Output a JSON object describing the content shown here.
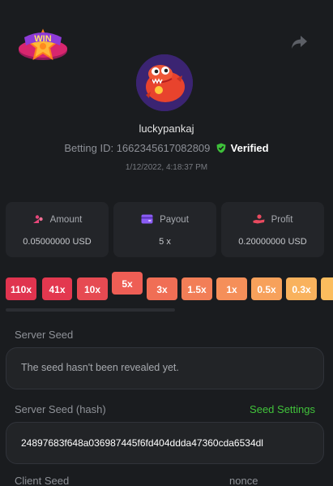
{
  "header": {
    "badge_text": "WIN",
    "share_icon": "share-icon"
  },
  "profile": {
    "username": "luckypankaj",
    "bet_id_label": "Betting ID:",
    "bet_id": "1662345617082809",
    "verified_label": "Verified",
    "date": "1/12/2022, 4:18:37 PM"
  },
  "stats": [
    {
      "label": "Amount",
      "value": "0.05000000 USD",
      "icon": "coins-icon",
      "color": "#e8467a"
    },
    {
      "label": "Payout",
      "value": "5 x",
      "icon": "wallet-icon",
      "color": "#8b5cf6"
    },
    {
      "label": "Profit",
      "value": "0.20000000 USD",
      "icon": "hand-coin-icon",
      "color": "#e84a5f"
    }
  ],
  "multipliers": [
    {
      "label": "110x",
      "color": "#e0344f"
    },
    {
      "label": "41x",
      "color": "#e3384f"
    },
    {
      "label": "10x",
      "color": "#e64a52"
    },
    {
      "label": "5x",
      "color": "#ee5e55",
      "active": true
    },
    {
      "label": "3x",
      "color": "#f06e55"
    },
    {
      "label": "1.5x",
      "color": "#f27e57"
    },
    {
      "label": "1x",
      "color": "#f58f59"
    },
    {
      "label": "0.5x",
      "color": "#f7a15b"
    },
    {
      "label": "0.3x",
      "color": "#f9b25d"
    },
    {
      "label": "",
      "color": "#fbbd5e"
    }
  ],
  "server_seed": {
    "label": "Server Seed",
    "value": "The seed hasn't been revealed yet."
  },
  "server_seed_hash": {
    "label": "Server Seed (hash)",
    "link": "Seed Settings",
    "value": "24897683f648a036987445f6fd404ddda47360cda6534dl"
  },
  "client_seed": {
    "label": "Client Seed"
  },
  "nonce": {
    "label": "nonce"
  },
  "colors": {
    "background": "#1a1c1f",
    "card": "#232529",
    "accent_green": "#41c33b"
  }
}
